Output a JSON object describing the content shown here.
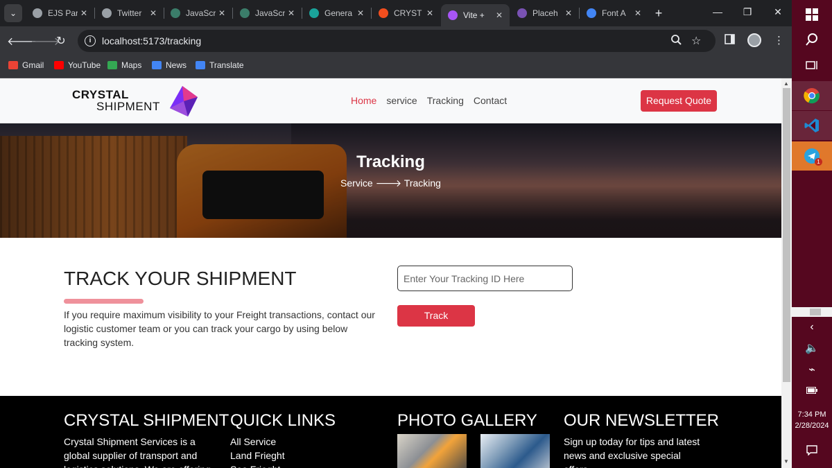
{
  "browser": {
    "tabs": [
      {
        "label": "EJS Par",
        "icon": "gear-icon",
        "color": "#9aa0a6"
      },
      {
        "label": "Twitter",
        "icon": "globe-icon",
        "color": "#9aa0a6"
      },
      {
        "label": "JavaScr",
        "icon": "openai-icon",
        "color": "#3b7d6a"
      },
      {
        "label": "JavaScr",
        "icon": "openai-icon",
        "color": "#3b7d6a"
      },
      {
        "label": "Genera",
        "icon": "diamond-icon",
        "color": "#1aa39a"
      },
      {
        "label": "CRYST",
        "icon": "figma-icon",
        "color": "#f24e1e"
      },
      {
        "label": "Vite +",
        "icon": "vite-icon",
        "color": "#a855f7"
      },
      {
        "label": "Placeh",
        "icon": "bootstrap-icon",
        "color": "#7952b3"
      },
      {
        "label": "Font A",
        "icon": "flag-icon",
        "color": "#4285f4"
      }
    ],
    "tab_close": "✕",
    "new_tab": "+",
    "url": "localhost:5173/tracking",
    "bookmarks": [
      {
        "label": "Gmail",
        "color": "#ea4335"
      },
      {
        "label": "YouTube",
        "color": "#ff0000"
      },
      {
        "label": "Maps",
        "color": "#34a853"
      },
      {
        "label": "News",
        "color": "#4285f4"
      },
      {
        "label": "Translate",
        "color": "#4285f4"
      }
    ]
  },
  "site": {
    "logo_line1": "CRYSTAL",
    "logo_line2": "SHIPMENT",
    "nav": [
      "Home",
      "service",
      "Tracking",
      "Contact"
    ],
    "quote_button": "Request Quote",
    "hero_title": "Tracking",
    "crumb_from": "Service",
    "crumb_arrow": "🡒",
    "crumb_to": "Tracking",
    "track_title": "TRACK YOUR SHIPMENT",
    "track_desc": "If you require maximum visibility to your Freight transactions, contact our logistic customer team or you can track your cargo by using below tracking system.",
    "track_placeholder": "Enter Your Tracking ID Here",
    "track_button": "Track",
    "accent": "#dc3545"
  },
  "footer": {
    "col1_title": "CRYSTAL SHIPMENT",
    "col1_text": "Crystal Shipment Services is a global supplier of transport and logistics solutions. We are offering",
    "col2_title": "QUICK LINKS",
    "col2_links": [
      "All Service",
      "Land Frieght",
      "Sea Frieght"
    ],
    "col3_title": "PHOTO GALLERY",
    "col4_title": "OUR NEWSLETTER",
    "col4_text": "Sign up today for tips and latest news and exclusive special offers."
  },
  "taskbar": {
    "time": "7:34 PM",
    "date": "2/28/2024",
    "telegram_badge": "1"
  }
}
